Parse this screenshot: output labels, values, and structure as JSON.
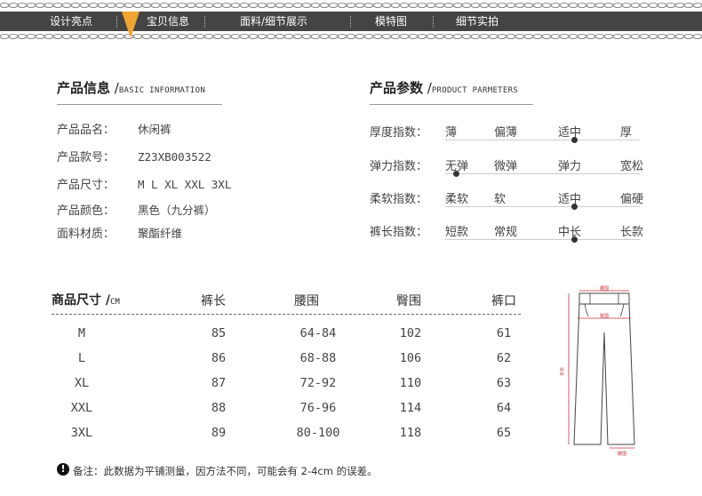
{
  "nav": {
    "tabs": [
      "设计亮点",
      "宝贝信息",
      "面料/细节展示",
      "模特图",
      "细节实拍"
    ],
    "active": "宝贝信息",
    "accent": "#f0a431",
    "bar_color": "#444444"
  },
  "product_info": {
    "title": "产品信息",
    "subtitle": "BASIC INFORMATION",
    "rows": [
      {
        "label": "产品品名：",
        "value": "休闲裤"
      },
      {
        "label": "产品款号：",
        "value": "Z23XB003522"
      },
      {
        "label": "产品尺寸：",
        "value": "M L XL XXL 3XL"
      },
      {
        "label": "产品颜色：",
        "value": "黑色（九分裤）"
      },
      {
        "label": "面料材质：",
        "value": "聚酯纤维"
      }
    ]
  },
  "product_params": {
    "title": "产品参数",
    "subtitle": "PRODUCT PARMETERS",
    "rows": [
      {
        "label": "厚度指数：",
        "options": [
          "薄",
          "偏薄",
          "适中",
          "厚"
        ],
        "selected_index": 2
      },
      {
        "label": "弹力指数：",
        "options": [
          "无弹",
          "微弹",
          "弹力",
          "宽松"
        ],
        "selected_index": 0
      },
      {
        "label": "柔软指数：",
        "options": [
          "柔软",
          "软",
          "适中",
          "偏硬"
        ],
        "selected_index": 2
      },
      {
        "label": "裤长指数：",
        "options": [
          "短款",
          "常规",
          "中长",
          "长款"
        ],
        "selected_index": 2
      }
    ]
  },
  "size_table": {
    "title": "商品尺寸",
    "unit": "CM",
    "headers": [
      "裤长",
      "腰围",
      "臀围",
      "裤口"
    ],
    "rows": [
      {
        "size": "M",
        "values": [
          "85",
          "64-84",
          "102",
          "61"
        ]
      },
      {
        "size": "L",
        "values": [
          "86",
          "68-88",
          "106",
          "62"
        ]
      },
      {
        "size": "XL",
        "values": [
          "87",
          "72-92",
          "110",
          "63"
        ]
      },
      {
        "size": "XXL",
        "values": [
          "88",
          "76-96",
          "114",
          "64"
        ]
      },
      {
        "size": "3XL",
        "values": [
          "89",
          "80-100",
          "118",
          "65"
        ]
      }
    ]
  },
  "diagram": {
    "labels": [
      "腰围",
      "臀围",
      "长长",
      "脚围"
    ],
    "line_color": "#c8323c"
  },
  "note": {
    "icon": "exclamation-icon",
    "text": "备注：此数据为平铺测量，因方法不同，可能会有 2-4cm 的误差。"
  }
}
